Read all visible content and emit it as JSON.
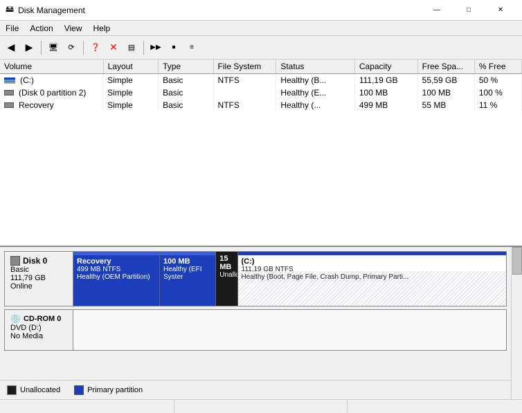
{
  "titleBar": {
    "title": "Disk Management",
    "icon": "💾",
    "controls": [
      "—",
      "□",
      "✕"
    ]
  },
  "menuBar": {
    "items": [
      "File",
      "Action",
      "View",
      "Help"
    ]
  },
  "toolbar": {
    "buttons": [
      "◀",
      "▶",
      "□□",
      "✎",
      "□",
      "⊟",
      "✕",
      "□",
      "▶▶",
      "⏹"
    ]
  },
  "table": {
    "columns": [
      "Volume",
      "Layout",
      "Type",
      "File System",
      "Status",
      "Capacity",
      "Free Spa...",
      "% Free"
    ],
    "rows": [
      {
        "volume": "(C:)",
        "layout": "Simple",
        "type": "Basic",
        "fileSystem": "NTFS",
        "status": "Healthy (B...",
        "capacity": "111,19 GB",
        "freeSpace": "55,59 GB",
        "percentFree": "50 %"
      },
      {
        "volume": "(Disk 0 partition 2)",
        "layout": "Simple",
        "type": "Basic",
        "fileSystem": "",
        "status": "Healthy (E...",
        "capacity": "100 MB",
        "freeSpace": "100 MB",
        "percentFree": "100 %"
      },
      {
        "volume": "Recovery",
        "layout": "Simple",
        "type": "Basic",
        "fileSystem": "NTFS",
        "status": "Healthy (...",
        "capacity": "499 MB",
        "freeSpace": "55 MB",
        "percentFree": "11 %"
      }
    ]
  },
  "diskVisual": {
    "disk0": {
      "label": "Disk 0",
      "sublabel1": "Basic",
      "sublabel2": "111,79 GB",
      "sublabel3": "Online",
      "partitions": [
        {
          "id": "recovery",
          "name": "Recovery",
          "size": "499 MB NTFS",
          "status": "Healthy (OEM Partition)"
        },
        {
          "id": "efi",
          "name": "100 MB",
          "size": "",
          "status": "Healthy (EFI Syster"
        },
        {
          "id": "unalloc",
          "name": "15 MB",
          "size": "",
          "status": "Unalloca..."
        },
        {
          "id": "c",
          "name": "(C:)",
          "size": "111,19 GB NTFS",
          "status": "Healthy (Boot, Page File, Crash Dump, Primary Parti..."
        }
      ]
    },
    "cdrom0": {
      "label": "CD-ROM 0",
      "sublabel1": "DVD (D:)",
      "sublabel2": "",
      "sublabel3": "No Media"
    }
  },
  "legend": {
    "items": [
      {
        "type": "unallocated",
        "label": "Unallocated"
      },
      {
        "type": "primary",
        "label": "Primary partition"
      }
    ]
  },
  "statusBar": {
    "sections": [
      "",
      "",
      ""
    ]
  }
}
